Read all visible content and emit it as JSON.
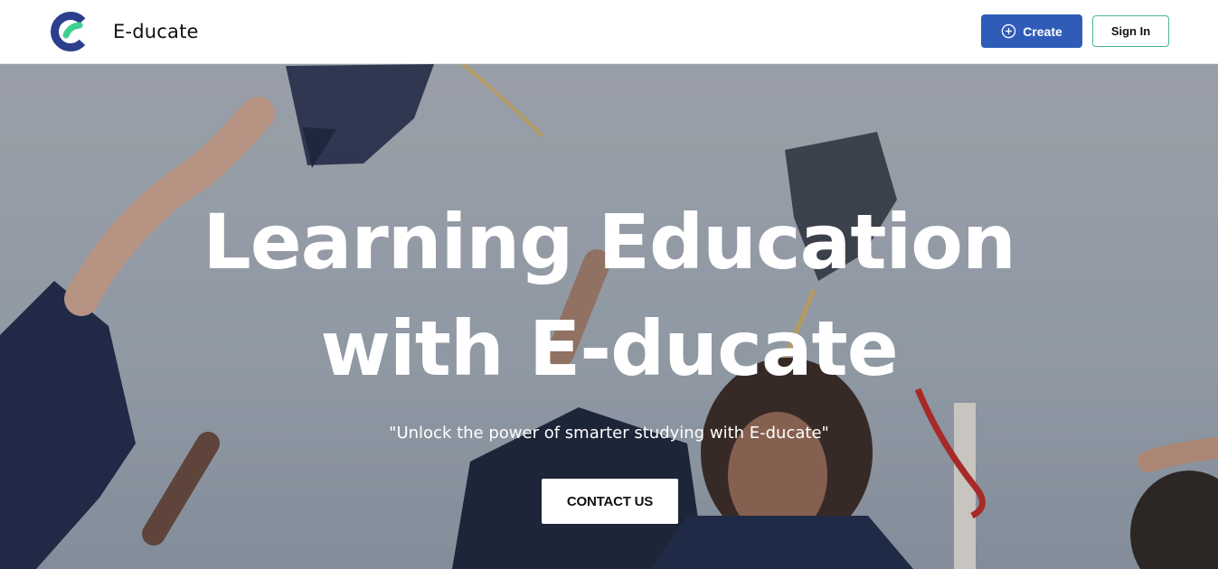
{
  "header": {
    "brand_name": "E-ducate",
    "create_label": "Create",
    "signin_label": "Sign In"
  },
  "hero": {
    "title_line1": "Learning Education",
    "title_line2": "with E-ducate",
    "subtitle": "\"Unlock the power of smarter studying with E-ducate\"",
    "cta_label": "CONTACT US"
  },
  "colors": {
    "primary": "#2f5cb8",
    "logo_navy": "#2b3f8c",
    "logo_green": "#3fcf8e",
    "signin_border": "#49b891"
  },
  "icons": {
    "logo": "e-ducate-logo",
    "create": "plus-circle-icon"
  }
}
